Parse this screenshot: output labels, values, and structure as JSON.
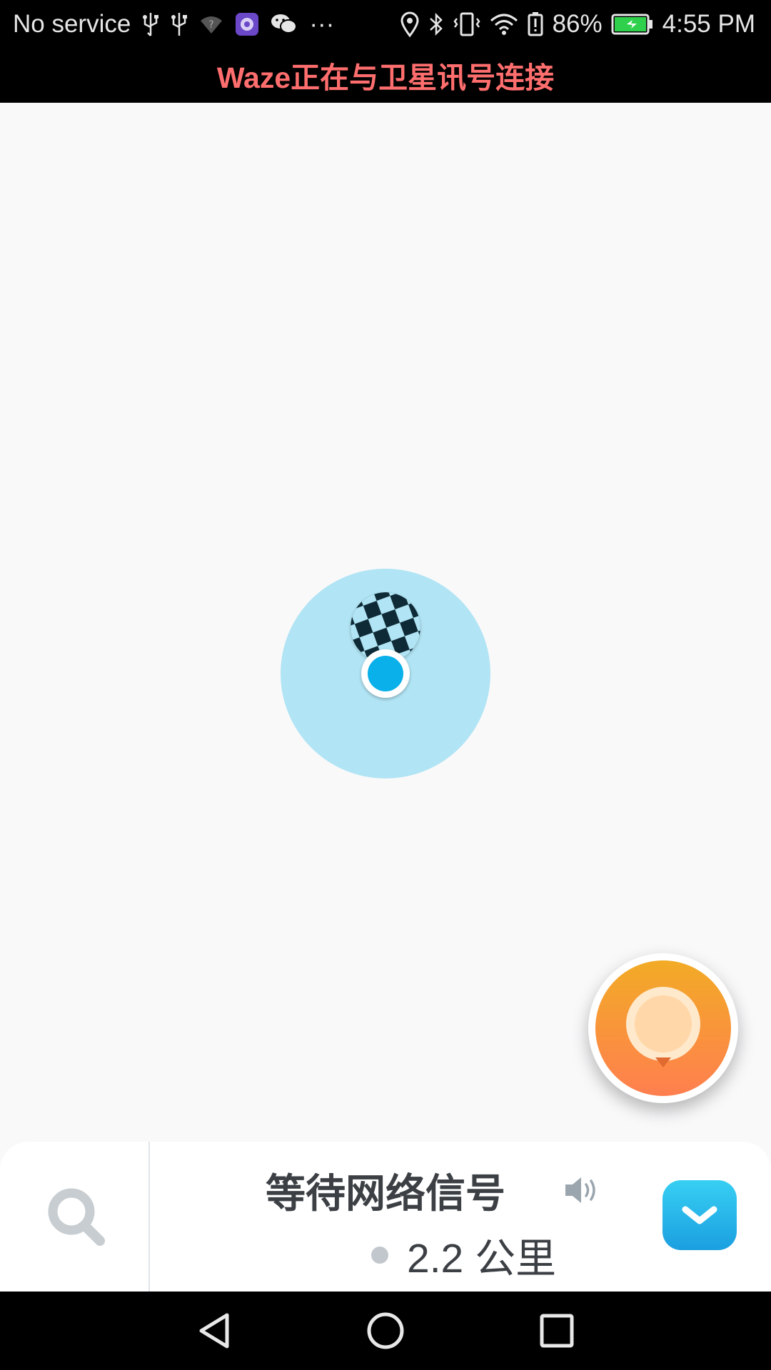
{
  "status_bar": {
    "carrier_text": "No service",
    "battery_percent": "86%",
    "time": "4:55 PM",
    "icons_left": [
      "usb-icon",
      "usb-icon",
      "wifi-question-icon",
      "app-notification-icon",
      "wechat-icon",
      "more-dots-icon"
    ],
    "icons_right": [
      "location-icon",
      "bluetooth-icon",
      "vibrate-icon",
      "wifi-icon",
      "battery-alert-icon",
      "battery-charging-icon"
    ],
    "more_dots": "···"
  },
  "banner": {
    "text": "Waze正在与卫星讯号连接",
    "color": "#ff6e6e"
  },
  "map": {
    "accuracy_color": "#b1e4f4",
    "location_dot_color": "#0ab0ea"
  },
  "report_button": {
    "icon": "report-bubble-icon",
    "gradient_top": "#f2ab26",
    "gradient_bottom": "#ff7f4f"
  },
  "bottom_bar": {
    "search_icon": "search-icon",
    "status_text": "等待网络信号",
    "sound_icon": "speaker-icon",
    "distance": "2.2 公里",
    "expand_icon": "chevron-down-icon",
    "accent_color": "#1b9fe0"
  },
  "nav_bar": {
    "buttons": [
      "back-icon",
      "home-icon",
      "recents-icon"
    ]
  }
}
